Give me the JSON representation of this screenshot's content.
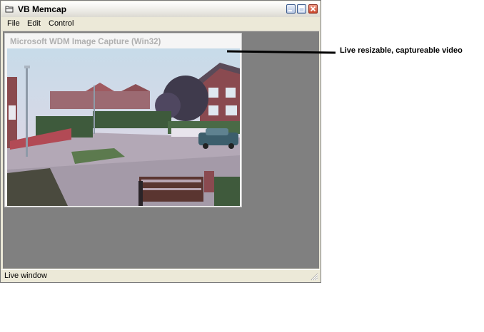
{
  "window": {
    "title": "VB Memcap"
  },
  "menu": {
    "file": "File",
    "edit": "Edit",
    "control": "Control"
  },
  "child_window": {
    "title": "Microsoft WDM Image Capture (Win32)"
  },
  "status": {
    "text": "Live window"
  },
  "annotation": {
    "text": "Live resizable, captureable video"
  },
  "icons": [
    "app-icon",
    "minimize-icon",
    "maximize-icon",
    "close-icon",
    "resize-grip-icon"
  ],
  "colors": {
    "client_background": "#808080",
    "close_button": "#c9452b"
  }
}
